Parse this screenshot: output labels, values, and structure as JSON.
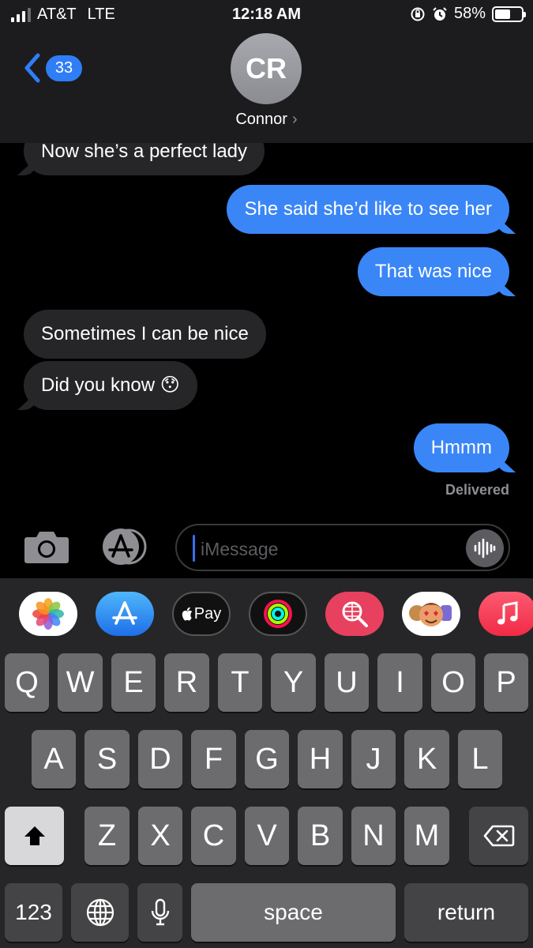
{
  "status_bar": {
    "carrier": "AT&T",
    "network": "LTE",
    "time": "12:18 AM",
    "battery": "58%",
    "battery_level": 0.58,
    "icons": [
      "signal-icon",
      "orientation-lock-icon",
      "alarm-icon",
      "battery-icon"
    ]
  },
  "nav": {
    "back_count": "33",
    "avatar_initials": "CR",
    "contact_name": "Connor",
    "contact_chevron": "›"
  },
  "messages": [
    {
      "from": "them",
      "text": "Now she’s a perfect lady"
    },
    {
      "from": "me",
      "text": "She said she’d like to see her"
    },
    {
      "from": "me",
      "text": "That was nice"
    },
    {
      "from": "them",
      "text": "Sometimes I can be nice"
    },
    {
      "from": "them",
      "text": "Did you know 😯"
    },
    {
      "from": "me",
      "text": "Hmmm"
    }
  ],
  "delivered_label": "Delivered",
  "input": {
    "placeholder": "iMessage"
  },
  "app_strip": {
    "apps": [
      "photos-app-icon",
      "app-store-icon",
      "apple-pay-icon",
      "activity-icon",
      "web-search-icon",
      "memoji-icon",
      "music-icon"
    ],
    "apple_pay_label": "Pay"
  },
  "keyboard": {
    "row1": [
      "Q",
      "W",
      "E",
      "R",
      "T",
      "Y",
      "U",
      "I",
      "O",
      "P"
    ],
    "row2": [
      "A",
      "S",
      "D",
      "F",
      "G",
      "H",
      "J",
      "K",
      "L"
    ],
    "row3": [
      "Z",
      "X",
      "C",
      "V",
      "B",
      "N",
      "M"
    ],
    "numbers_label": "123",
    "space_label": "space",
    "return_label": "return"
  }
}
